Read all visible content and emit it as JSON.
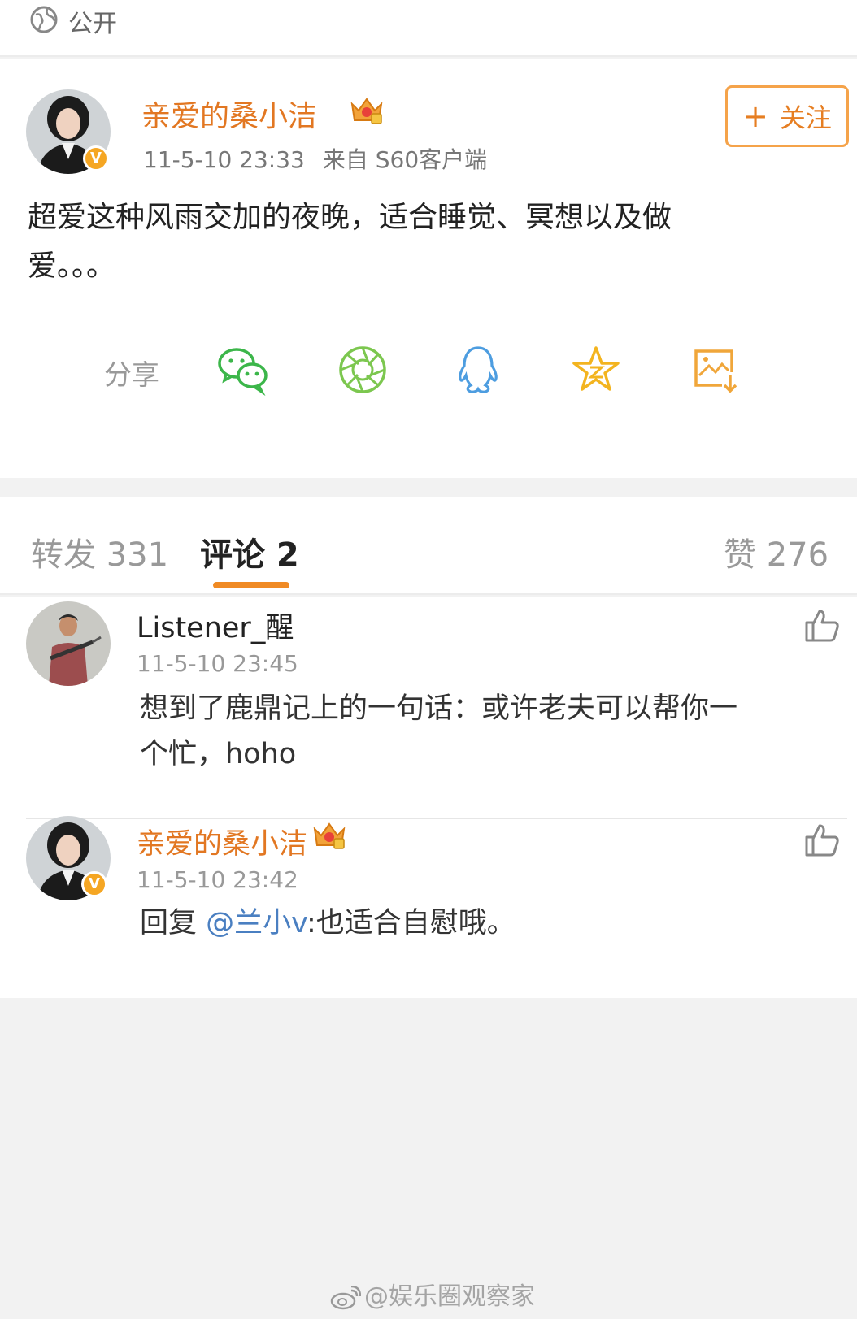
{
  "visibility": {
    "label": "公开",
    "icon": "globe-icon"
  },
  "post": {
    "author": "亲爱的桑小洁",
    "badge": "V",
    "time": "11-5-10 23:33",
    "source": "来自 S60客户端",
    "follow_label": "关注",
    "follow_plus": "+",
    "text_line1": "超爱这种风雨交加的夜晚，适合睡觉、冥想以及做",
    "text_line2": "爱。。。"
  },
  "share": {
    "label": "分享",
    "icons": [
      "wechat-icon",
      "moments-icon",
      "qq-icon",
      "favorite-star-icon",
      "save-image-icon"
    ]
  },
  "tabs": [
    {
      "label": "转发 331",
      "active": false
    },
    {
      "label": "评论 2",
      "active": true
    },
    {
      "label": "赞 276",
      "active": false
    }
  ],
  "comments": [
    {
      "name": "Listener_醒",
      "time": "11-5-10 23:45",
      "text_line1": "想到了鹿鼎记上的一句话：或许老夫可以帮你一",
      "text_line2": "个忙，hoho"
    },
    {
      "name": "亲爱的桑小洁",
      "badge": "V",
      "time": "11-5-10 23:42",
      "reply_prefix": "回复",
      "mention": "@兰小v",
      "text": ":也适合自慰哦。"
    }
  ],
  "watermark": "@娱乐圈观察家",
  "colors": {
    "accent": "#e27722",
    "follow_border": "#f5a34a",
    "mention": "#4a7fc1",
    "tab_indicator": "#f08a24"
  }
}
